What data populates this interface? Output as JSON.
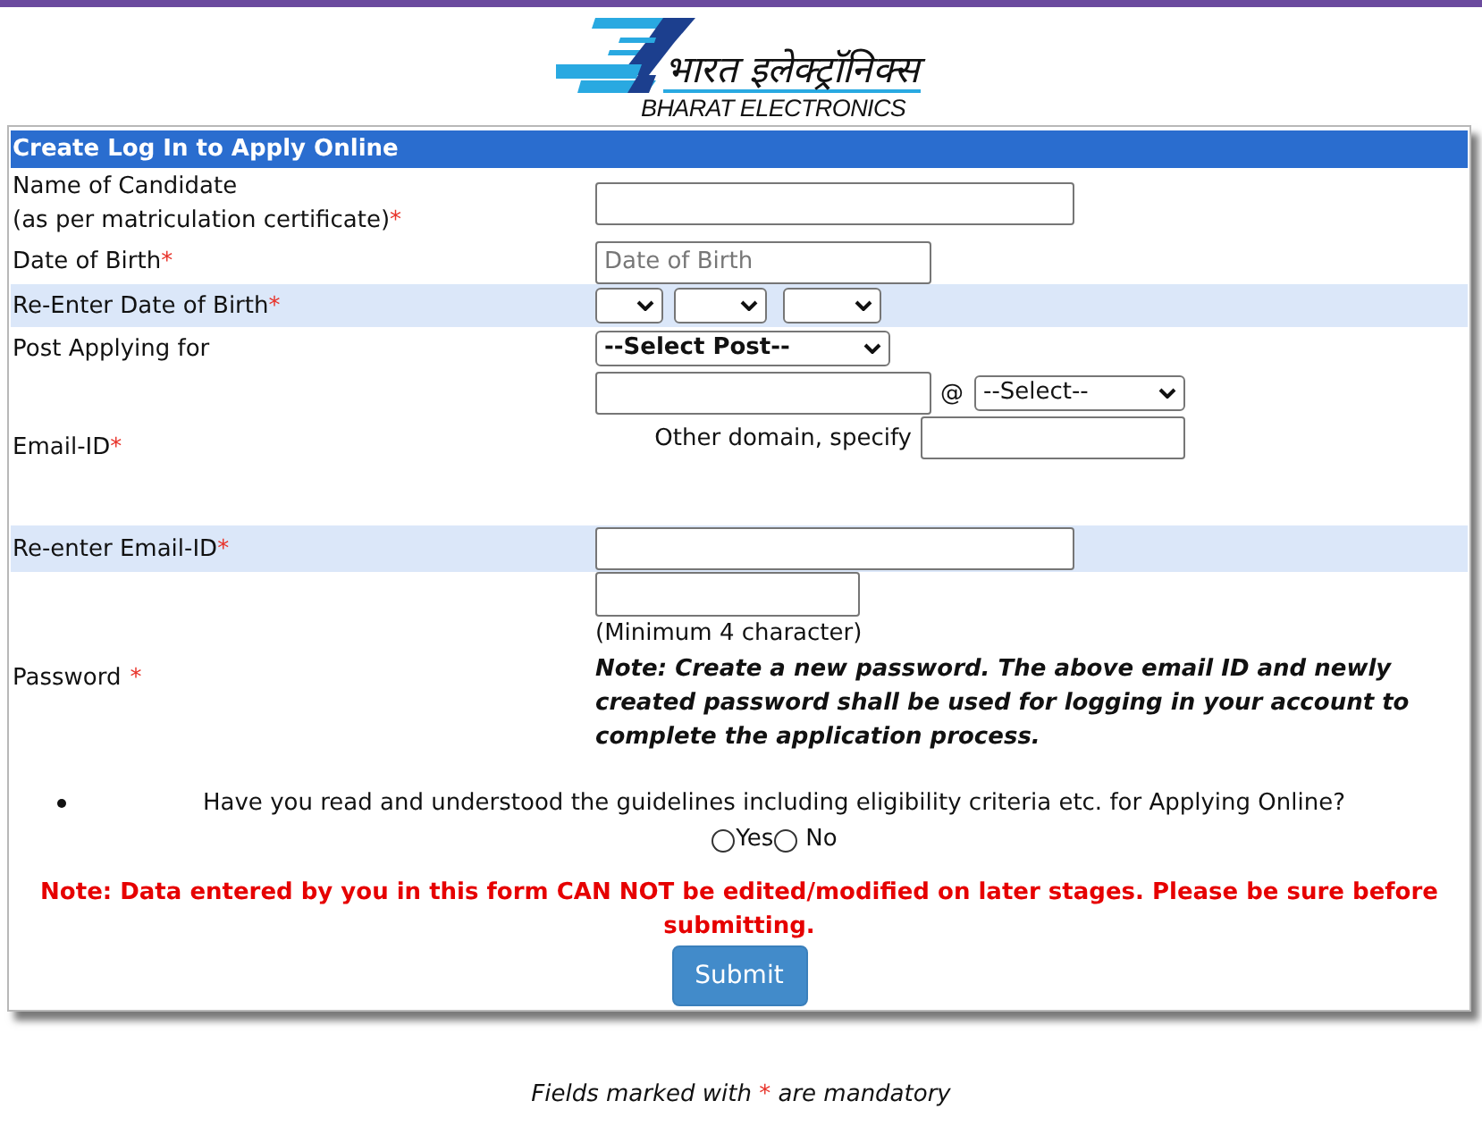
{
  "logo": {
    "hindi": "भारत इलेक्ट्रॉनिक्स",
    "english": "BHARAT ELECTRONICS"
  },
  "form": {
    "title": "Create Log In to Apply Online",
    "rows": [
      {
        "kind": "text",
        "label": "Name of Candidate",
        "label_note": "(as per matriculation certificate)",
        "mark": "*",
        "highlighted": false
      },
      {
        "kind": "date",
        "label": "Date of Birth",
        "mark": "*",
        "placeholder": "Date of Birth",
        "highlighted": false
      },
      {
        "kind": "date_selects",
        "label": "Re-Enter Date of Birth",
        "mark": "*",
        "highlighted": true
      },
      {
        "kind": "select",
        "label": "Post Applying for",
        "value": "--Select Post--",
        "highlighted": false
      },
      {
        "kind": "email",
        "label": "Email-ID",
        "mark": "*",
        "at": "@",
        "domain": "--Select--",
        "other_label": "Other domain, specify",
        "highlighted": false
      },
      {
        "kind": "text",
        "label": "Re-enter Email-ID",
        "mark": "*",
        "highlighted": true
      },
      {
        "kind": "password",
        "label": "Password",
        "mark": "*",
        "hint": "(Minimum 4 character)",
        "note": "Note: Create a new password. The above email ID and newly created password shall be used for logging in your account to complete the application process.",
        "highlighted": false
      }
    ],
    "question": {
      "text": "Have you read and understood the guidelines including eligibility criteria etc. for Applying Online?",
      "options": [
        {
          "label": "Yes",
          "selected": false
        },
        {
          "label": "No",
          "selected": false
        }
      ]
    },
    "warning": "Note: Data entered by you in this form CAN NOT be edited/modified on later stages. Please be sure before submitting.",
    "submit": "Submit"
  },
  "footer": {
    "before": "Fields marked with",
    "mark": "*",
    "after": "are mandatory"
  }
}
